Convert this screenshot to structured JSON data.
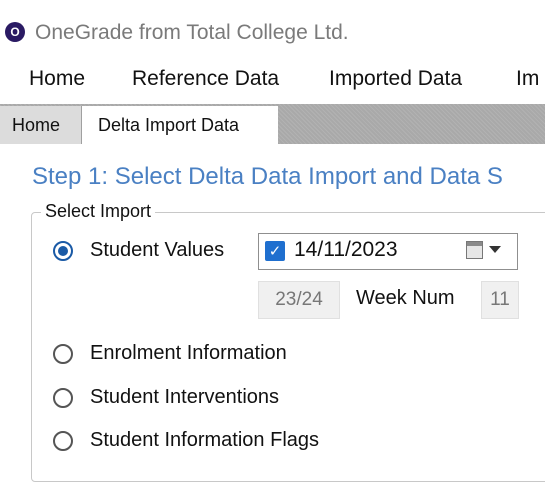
{
  "window": {
    "icon_text": "O",
    "title": "OneGrade from Total College Ltd."
  },
  "menu": {
    "items": [
      "Home",
      "Reference Data",
      "Imported Data",
      "Im"
    ]
  },
  "tabs": [
    {
      "label": "Home",
      "active": false
    },
    {
      "label": "Delta Import Data",
      "active": true
    }
  ],
  "step": {
    "title": "Step 1: Select Delta Data Import and Data S"
  },
  "select_import": {
    "group_label": "Select Import",
    "options": [
      {
        "label": "Student Values",
        "selected": true
      },
      {
        "label": "Enrolment Information",
        "selected": false
      },
      {
        "label": "Student Interventions",
        "selected": false
      },
      {
        "label": "Student Information Flags",
        "selected": false
      }
    ],
    "date_picker": {
      "checked": true,
      "value": "14/11/2023",
      "icon": "calendar-icon"
    },
    "academic_year": "23/24",
    "week_label": "Week Num",
    "week_value": "11"
  },
  "colors": {
    "accent": "#1a5aa6",
    "step_title": "#4a80c3",
    "tab_strip": "#a9a9a9",
    "checkbox": "#1f6fcf"
  }
}
